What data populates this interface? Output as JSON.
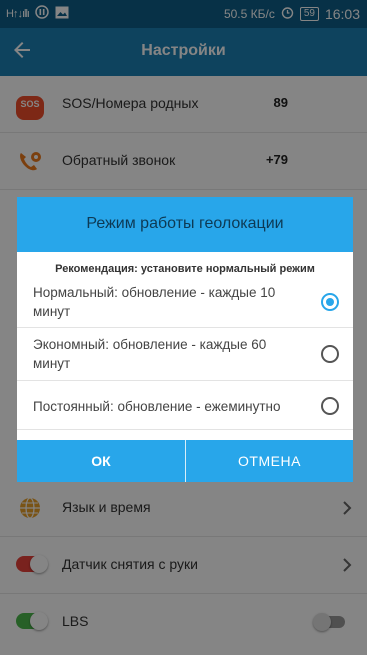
{
  "statusbar": {
    "signal": "H",
    "speed": "50.5 КБ/с",
    "battery": "59",
    "time": "16:03"
  },
  "appbar": {
    "title": "Настройки"
  },
  "rows": [
    {
      "label": "SOS/Номера родных",
      "value": "89",
      "badge": "SOS"
    },
    {
      "label": "Обратный звонок",
      "value": "+79"
    },
    {
      "label": "Язык и время"
    },
    {
      "label": "Датчик снятия с руки"
    },
    {
      "label": "LBS"
    }
  ],
  "dialog": {
    "title": "Режим работы геолокации",
    "recommendation": "Рекомендация: установите нормальный режим",
    "options": [
      {
        "label": "Нормальный: обновление - каждые 10 минут",
        "selected": true
      },
      {
        "label": "Экономный: обновление - каждые 60 минут",
        "selected": false
      },
      {
        "label": "Постоянный: обновление - ежеминутно",
        "selected": false
      }
    ],
    "ok_label": "ОК",
    "cancel_label": "ОТМЕНА"
  },
  "colors": {
    "appbar": "#1b80b4",
    "dialog_accent": "#28a6ea",
    "toggle_on": "#4cb94c",
    "toggle_alert": "#e8413a"
  }
}
